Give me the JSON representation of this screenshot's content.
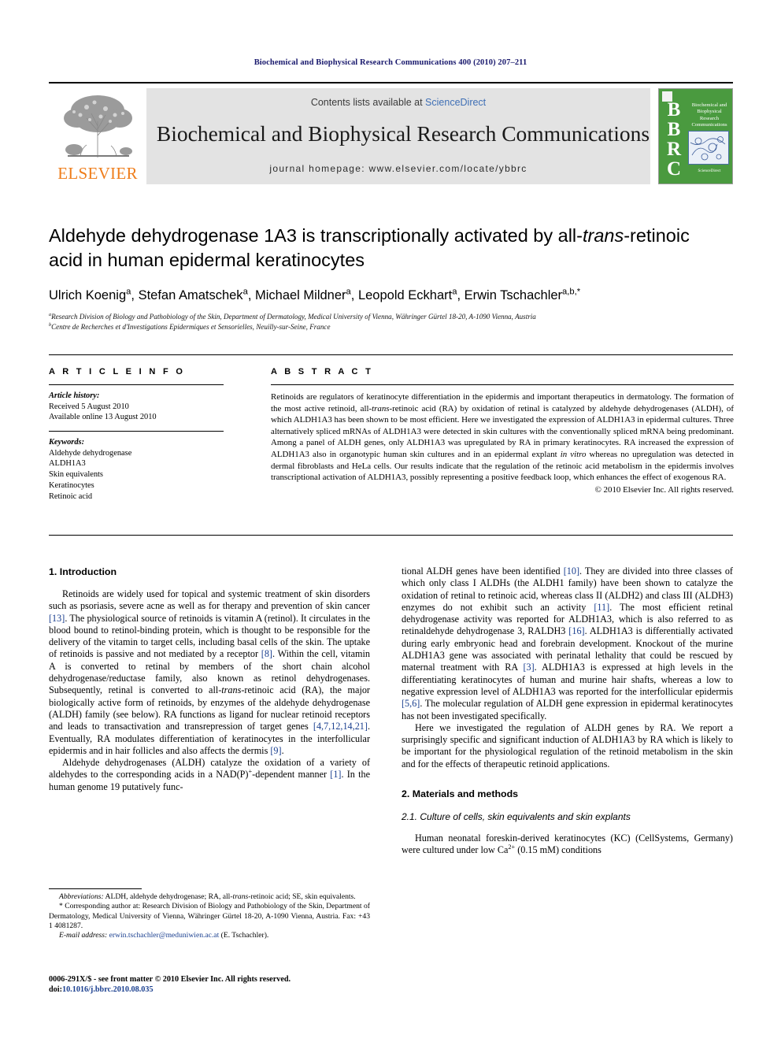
{
  "running_head": "Biochemical and Biophysical Research Communications 400 (2010) 207–211",
  "masthead": {
    "contents_prefix": "Contents lists available at ",
    "sciencedirect": "ScienceDirect",
    "journal_title": "Biochemical and Biophysical Research Communications",
    "homepage": "journal homepage: www.elsevier.com/locate/ybbrc",
    "publisher_wordmark": "ELSEVIER",
    "cover": {
      "letters": "B\nB\nR\nC",
      "title_lines": "Biochemical and Biophysical Research Communications",
      "footer": "ScienceDirect"
    },
    "colors": {
      "banner_bg": "#e3e3e3",
      "sciencedirect_blue": "#3f6fb5",
      "elsevier_orange": "#ef7d1a",
      "cover_green": "#4a9a3f"
    }
  },
  "article": {
    "title_part1": "Aldehyde dehydrogenase 1A3 is transcriptionally activated by all-",
    "title_italic": "trans",
    "title_part2": "-retinoic acid in human epidermal keratinocytes",
    "authors_plain": "Ulrich Koenig",
    "authors_full": "Ulrich Koenig a, Stefan Amatschek a, Michael Mildner a, Leopold Eckhart a, Erwin Tschachler a,b,*",
    "affiliation_a": "Research Division of Biology and Pathobiology of the Skin, Department of Dermatology, Medical University of Vienna, Währinger Gürtel 18-20, A-1090 Vienna, Austria",
    "affiliation_b": "Centre de Recherches et d'Investigations Epidermiques et Sensorielles, Neuilly-sur-Seine, France",
    "author_list": [
      {
        "name": "Ulrich Koenig",
        "marks": "a"
      },
      {
        "name": "Stefan Amatschek",
        "marks": "a"
      },
      {
        "name": "Michael Mildner",
        "marks": "a"
      },
      {
        "name": "Leopold Eckhart",
        "marks": "a"
      },
      {
        "name": "Erwin Tschachler",
        "marks": "a,b,*"
      }
    ]
  },
  "article_info": {
    "heading": "A R T I C L E  I N F O",
    "history_label": "Article history:",
    "history_lines": [
      "Received 5 August 2010",
      "Available online 13 August 2010"
    ],
    "keywords_label": "Keywords:",
    "keywords": [
      "Aldehyde dehydrogenase",
      "ALDH1A3",
      "Skin equivalents",
      "Keratinocytes",
      "Retinoic acid"
    ]
  },
  "abstract": {
    "heading": "A B S T R A C T",
    "text_before_italic1": "Retinoids are regulators of keratinocyte differentiation in the epidermis and important therapeutics in dermatology. The formation of the most active retinoid, all-",
    "italic1": "trans",
    "text_mid": "-retinoic acid (RA) by oxidation of retinal is catalyzed by aldehyde dehydrogenases (ALDH), of which ALDH1A3 has been shown to be most efficient. Here we investigated the expression of ALDH1A3 in epidermal cultures. Three alternatively spliced mRNAs of ALDH1A3 were detected in skin cultures with the conventionally spliced mRNA being predominant. Among a panel of ALDH genes, only ALDH1A3 was upregulated by RA in primary keratinocytes. RA increased the expression of ALDH1A3 also in organotypic human skin cultures and in an epidermal explant ",
    "italic2": "in vitro",
    "text_after": " whereas no upregulation was detected in dermal fibroblasts and HeLa cells. Our results indicate that the regulation of the retinoic acid metabolism in the epidermis involves transcriptional activation of ALDH1A3, possibly representing a positive feedback loop, which enhances the effect of exogenous RA.",
    "copyright": "© 2010 Elsevier Inc. All rights reserved."
  },
  "body": {
    "intro_heading": "1. Introduction",
    "left_p1_a": "Retinoids are widely used for topical and systemic treatment of skin disorders such as psoriasis, severe acne as well as for therapy and prevention of skin cancer ",
    "left_p1_ref1": "[13]",
    "left_p1_b": ". The physiological source of retinoids is vitamin A (retinol). It circulates in the blood bound to retinol-binding protein, which is thought to be responsible for the delivery of the vitamin to target cells, including basal cells of the skin. The uptake of retinoids is passive and not mediated by a receptor ",
    "left_p1_ref2": "[8]",
    "left_p1_c": ". Within the cell, vitamin A is converted to retinal by members of the short chain alcohol dehydrogenase/reductase family, also known as retinol dehydrogenases. Subsequently, retinal is converted to all-",
    "left_p1_ital": "trans",
    "left_p1_d": "-retinoic acid (RA), the major biologically active form of retinoids, by enzymes of the aldehyde dehydrogenase (ALDH) family (see below). RA functions as ligand for nuclear retinoid receptors and leads to transactivation and transrepression of target genes ",
    "left_p1_ref3": "[4,7,12,14,21]",
    "left_p1_e": ". Eventually, RA modulates differentiation of keratinocytes in the interfollicular epidermis and in hair follicles and also affects the dermis ",
    "left_p1_ref4": "[9]",
    "left_p1_f": ".",
    "left_p2_a": "Aldehyde dehydrogenases (ALDH) catalyze the oxidation of a variety of aldehydes to the corresponding acids in a NAD(P)",
    "left_p2_sup": "+",
    "left_p2_b": "-dependent manner ",
    "left_p2_ref": "[1]",
    "left_p2_c": ". In the human genome 19 putatively func-",
    "right_p1_a": "tional ALDH genes have been identified ",
    "right_p1_ref1": "[10]",
    "right_p1_b": ". They are divided into three classes of which only class I ALDHs (the ALDH1 family) have been shown to catalyze the oxidation of retinal to retinoic acid, whereas class II (ALDH2) and class III (ALDH3) enzymes do not exhibit such an activity ",
    "right_p1_ref2": "[11]",
    "right_p1_c": ". The most efficient retinal dehydrogenase activity was reported for ALDH1A3, which is also referred to as retinaldehyde dehydrogenase 3, RALDH3 ",
    "right_p1_ref3": "[16]",
    "right_p1_d": ". ALDH1A3 is differentially activated during early embryonic head and forebrain development. Knockout of the murine ALDH1A3 gene was associated with perinatal lethality that could be rescued by maternal treatment with RA ",
    "right_p1_ref4": "[3]",
    "right_p1_e": ". ALDH1A3 is expressed at high levels in the differentiating keratinocytes of human and murine hair shafts, whereas a low to negative expression level of ALDH1A3 was reported for the interfollicular epidermis ",
    "right_p1_ref5": "[5,6]",
    "right_p1_f": ". The molecular regulation of ALDH gene expression in epidermal keratinocytes has not been investigated specifically.",
    "right_p2": "Here we investigated the regulation of ALDH genes by RA. We report a surprisingly specific and significant induction of ALDH1A3 by RA which is likely to be important for the physiological regulation of the retinoid metabolism in the skin and for the effects of therapeutic retinoid applications.",
    "methods_heading": "2. Materials and methods",
    "methods_subheading": "2.1. Culture of cells, skin equivalents and skin explants",
    "right_p3_a": "Human neonatal foreskin-derived keratinocytes (KC) (CellSystems, Germany) were cultured under low Ca",
    "right_p3_sup": "2+",
    "right_p3_b": " (0.15 mM) conditions"
  },
  "footnotes": {
    "abbrev_label": "Abbreviations:",
    "abbrev_a": " ALDH, aldehyde dehydrogenase; RA, all-",
    "abbrev_ital": "trans",
    "abbrev_b": "-retinoic acid; SE, skin equivalents.",
    "corresponding_marker": "*",
    "corresponding": " Corresponding author at: Research Division of Biology and Pathobiology of the Skin, Department of Dermatology, Medical University of Vienna, Währinger Gürtel 18-20, A-1090 Vienna, Austria. Fax: +43 1 4081287.",
    "email_label": "E-mail address:",
    "email": "erwin.tschachler@meduniwien.ac.at",
    "email_owner": " (E. Tschachler).",
    "issn_line": "0006-291X/$ - see front matter © 2010 Elsevier Inc. All rights reserved.",
    "doi_label": "doi:",
    "doi_value": "10.1016/j.bbrc.2010.08.035"
  }
}
